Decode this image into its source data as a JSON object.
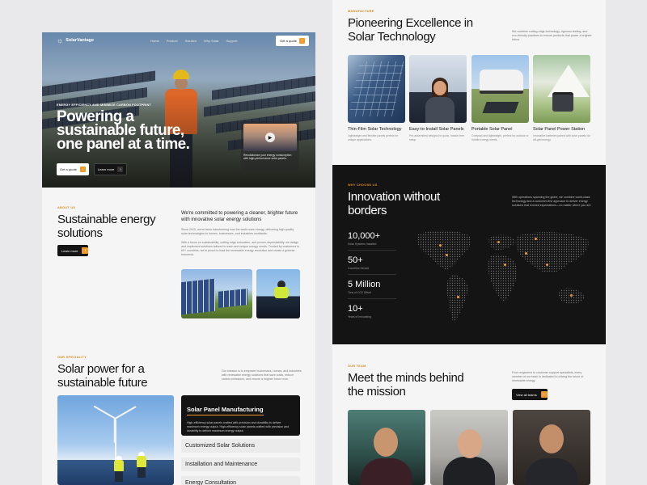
{
  "brand": {
    "name": "SolarVantage"
  },
  "nav": {
    "links": [
      "Home",
      "Product",
      "Solution",
      "Why Solar",
      "Support"
    ],
    "cta": "Get a quote"
  },
  "hero": {
    "eyebrow": "ENERGY EFFICIENCY AND MINIMIZE CARBON FOOTPRINT",
    "title": "Powering a sustainable future, one panel at a time.",
    "primary_cta": "Get a quote",
    "secondary_cta": "Learn more",
    "video_caption": "Revolutionize your energy consumption with high-performance solar panels."
  },
  "about": {
    "eyebrow": "ABOUT US",
    "title": "Sustainable energy solutions",
    "lead": "We're committed to powering a cleaner, brighter future with innovative solar energy solutions",
    "para1": "Since 2010, we've been transforming how the world uses energy, delivering high-quality solar technologies to homes, businesses, and industries worldwide.",
    "para2": "With a focus on sustainability, cutting-edge innovation, and proven dependability, we design and implement solutions tailored to each and unique energy needs. Trusted by customers in 60+ countries, we're proud to lead the renewable energy revolution and create a greener tomorrow.",
    "cta": "Learn more"
  },
  "specialty": {
    "eyebrow": "OUR SPECIALITY",
    "title": "Solar power for a sustainable future",
    "intro": "Our mission is to empower businesses, homes, and industries with renewable energy solutions that save costs, reduce carbon emissions, and ensure a brighter future now.",
    "active": {
      "title": "Solar Panel Manufacturing",
      "desc": "High-efficiency solar panels crafted with precision and durability to deliver maximum energy output. High-efficiency solar panels crafted with precision and durability to deliver maximum energy output."
    },
    "items": [
      "Customized Solar Solutions",
      "Installation and Maintenance",
      "Energy Consultation"
    ]
  },
  "products": {
    "eyebrow": "MANUFACTURE",
    "title": "Pioneering Excellence in Solar Technology",
    "intro": "We combine cutting-edge technology, rigorous testing, and eco-friendly practices to ensure products that power a brighter future.",
    "items": [
      {
        "name": "Thin-Film Solar Technology",
        "desc": "Lightweight and flexible panels perfect for unique applications."
      },
      {
        "name": "Easy-to-Install Solar Panels",
        "desc": "Pre-assembled designs for quick, hassle-free setup."
      },
      {
        "name": "Portable Solar Panel",
        "desc": "Compact and lightweight, perfect for outdoor or mobile energy needs."
      },
      {
        "name": "Solar Panel Power Station",
        "desc": "Innovative batteries paired with solar panels for off-grid energy."
      }
    ]
  },
  "why": {
    "eyebrow": "WHY CHOOSE US",
    "title": "Innovation without borders",
    "intro": "With operations spanning the globe, we combine world-class technology and a customer-first approach to deliver energy solutions that exceed expectations—no matter where you are.",
    "stats": [
      {
        "num": "10,000+",
        "label": "Solar Systems Installed"
      },
      {
        "num": "50+",
        "label": "Countries Served"
      },
      {
        "num": "5 Million",
        "label": "Tons of CO2 Offset"
      },
      {
        "num": "10+",
        "label": "Years of Innovating"
      }
    ]
  },
  "team": {
    "eyebrow": "OUR TEAM",
    "title": "Meet the minds behind the mission",
    "intro": "From engineers to customer support specialists, every member of our team is dedicated to driving the future of renewable energy.",
    "cta": "View all teams"
  },
  "colors": {
    "accent": "#f09a2a",
    "dark": "#141414",
    "light": "#f5f5f6"
  },
  "icons": {
    "logo": "sun-icon",
    "arrow": "chevron-right-icon",
    "play": "play-icon"
  }
}
